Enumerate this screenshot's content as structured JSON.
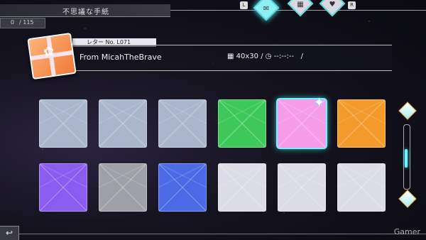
{
  "header": {
    "title": "不思議な手紙",
    "count_current": "0",
    "count_total": "/ 115"
  },
  "tabs": {
    "left_key": "L",
    "right_key": "R"
  },
  "letter": {
    "label": "レター No. L071",
    "from": "From MicahTheBrave",
    "size": "40x30",
    "time": "--:--:--",
    "slash": "/"
  },
  "envelopes": [
    {
      "color": "#a9b6cc"
    },
    {
      "color": "#a9b6cc"
    },
    {
      "color": "#a9b6cc"
    },
    {
      "color": "#3fc85a"
    },
    {
      "color": "#f59ce8",
      "selected": true
    },
    {
      "color": "#f39a2a"
    },
    {
      "color": "#8a5cf0"
    },
    {
      "color": "#a0a0a8"
    },
    {
      "color": "#4a6ae6"
    },
    {
      "color": "#dcdce6"
    },
    {
      "color": "#dcdce6"
    },
    {
      "color": "#dcdce6"
    }
  ],
  "watermark": "Gamer",
  "colors": {
    "accent": "#6ff4ff"
  }
}
